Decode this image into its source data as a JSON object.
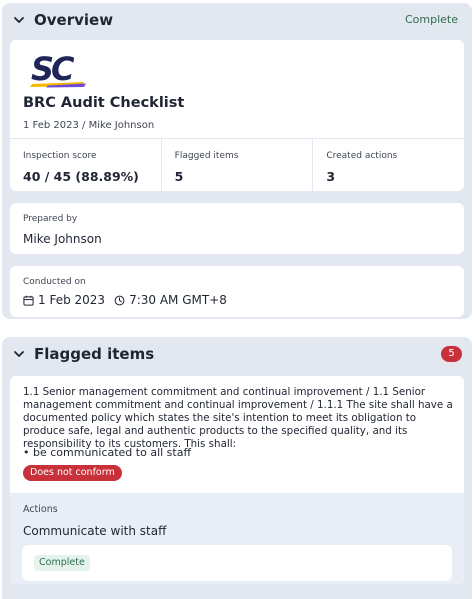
{
  "overview": {
    "title": "Overview",
    "status": "Complete",
    "logo_text": "SC",
    "doc_title": "BRC Audit Checklist",
    "doc_meta": "1 Feb 2023 / Mike Johnson",
    "stats": [
      {
        "label": "Inspection score",
        "value": "40 / 45 (88.89%)"
      },
      {
        "label": "Flagged items",
        "value": "5"
      },
      {
        "label": "Created actions",
        "value": "3"
      }
    ],
    "prepared_by": {
      "label": "Prepared by",
      "value": "Mike Johnson"
    },
    "conducted_on": {
      "label": "Conducted on",
      "date": "1 Feb 2023",
      "time": "7:30 AM GMT+8"
    }
  },
  "flagged": {
    "title": "Flagged items",
    "count": "5",
    "items": [
      {
        "question": "1.1 Senior management commitment and continual improvement / 1.1 Senior management commitment and continual improvement / 1.1.1 The site shall have a documented policy which states the site's intention to meet its obligation to produce safe, legal and authentic products to the specified quality, and its responsibility to its customers. This shall:",
        "bullet": "• be communicated to all staff",
        "response": "Does not conform",
        "actions_label": "Actions",
        "action_title": "Communicate with staff",
        "action_status": "Complete"
      }
    ]
  },
  "colors": {
    "section_bg": "#e3e7ef",
    "flag_red": "#c9313a",
    "complete_green": "#2d6c4f",
    "logo_navy": "#1f2557"
  },
  "icons": [
    "chevron-down-icon",
    "calendar-icon",
    "clock-icon"
  ]
}
